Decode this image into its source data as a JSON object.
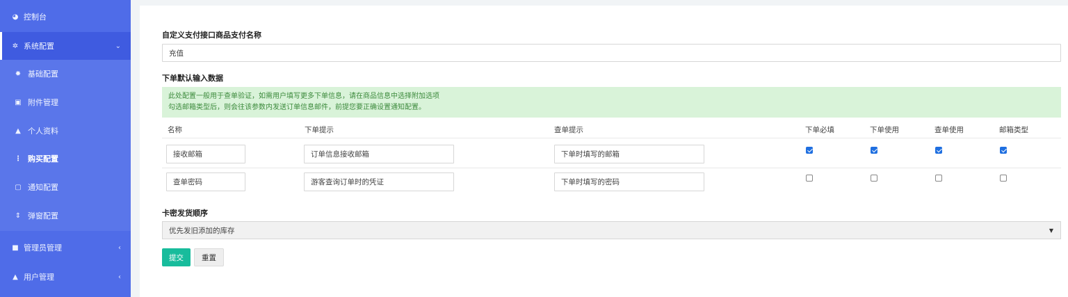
{
  "sidebar": {
    "items": [
      {
        "icon": "dashboard-icon",
        "glyph": "◕",
        "label": "控制台"
      },
      {
        "icon": "gears-icon",
        "glyph": "✲",
        "label": "系统配置",
        "caret": "⌄"
      },
      {
        "icon": "gear-icon",
        "glyph": "✹",
        "label": "基础配置"
      },
      {
        "icon": "image-icon",
        "glyph": "▣",
        "label": "附件管理"
      },
      {
        "icon": "user-icon",
        "glyph": "▲",
        "label": "个人资料"
      },
      {
        "icon": "ellipsis-icon",
        "glyph": "⋮",
        "label": "购买配置"
      },
      {
        "icon": "message-icon",
        "glyph": "▢",
        "label": "通知配置"
      },
      {
        "icon": "sort-icon",
        "glyph": "⇕",
        "label": "弹窗配置"
      },
      {
        "icon": "windows-icon",
        "glyph": "■",
        "label": "管理员管理",
        "caret": "‹"
      },
      {
        "icon": "user-icon",
        "glyph": "▲",
        "label": "用户管理",
        "caret": "‹"
      }
    ]
  },
  "form": {
    "product_name_title": "自定义支付接口商品支付名称",
    "product_name_value": "充值",
    "order_default_title": "下单默认输入数据",
    "alert_line1": "此处配置一般用于查单验证，如需用户填写更多下单信息，请在商品信息中选择附加选项",
    "alert_line2": "勾选邮箱类型后，则会往该参数内发送订单信息邮件，前提您要正确设置通知配置。",
    "table": {
      "headers": [
        "名称",
        "下单提示",
        "查单提示",
        "下单必填",
        "下单使用",
        "查单使用",
        "邮箱类型"
      ],
      "rows": [
        {
          "name": "接收邮箱",
          "order_hint": "订单信息接收邮箱",
          "query_hint": "下单时填写的邮箱",
          "checks": [
            true,
            true,
            true,
            true
          ]
        },
        {
          "name": "查单密码",
          "order_hint": "游客查询订单时的凭证",
          "query_hint": "下单时填写的密码",
          "checks": [
            false,
            false,
            false,
            false
          ]
        }
      ]
    },
    "card_order_title": "卡密发货顺序",
    "card_order_selected": "优先发旧添加的库存",
    "submit_label": "提交",
    "reset_label": "重置"
  }
}
